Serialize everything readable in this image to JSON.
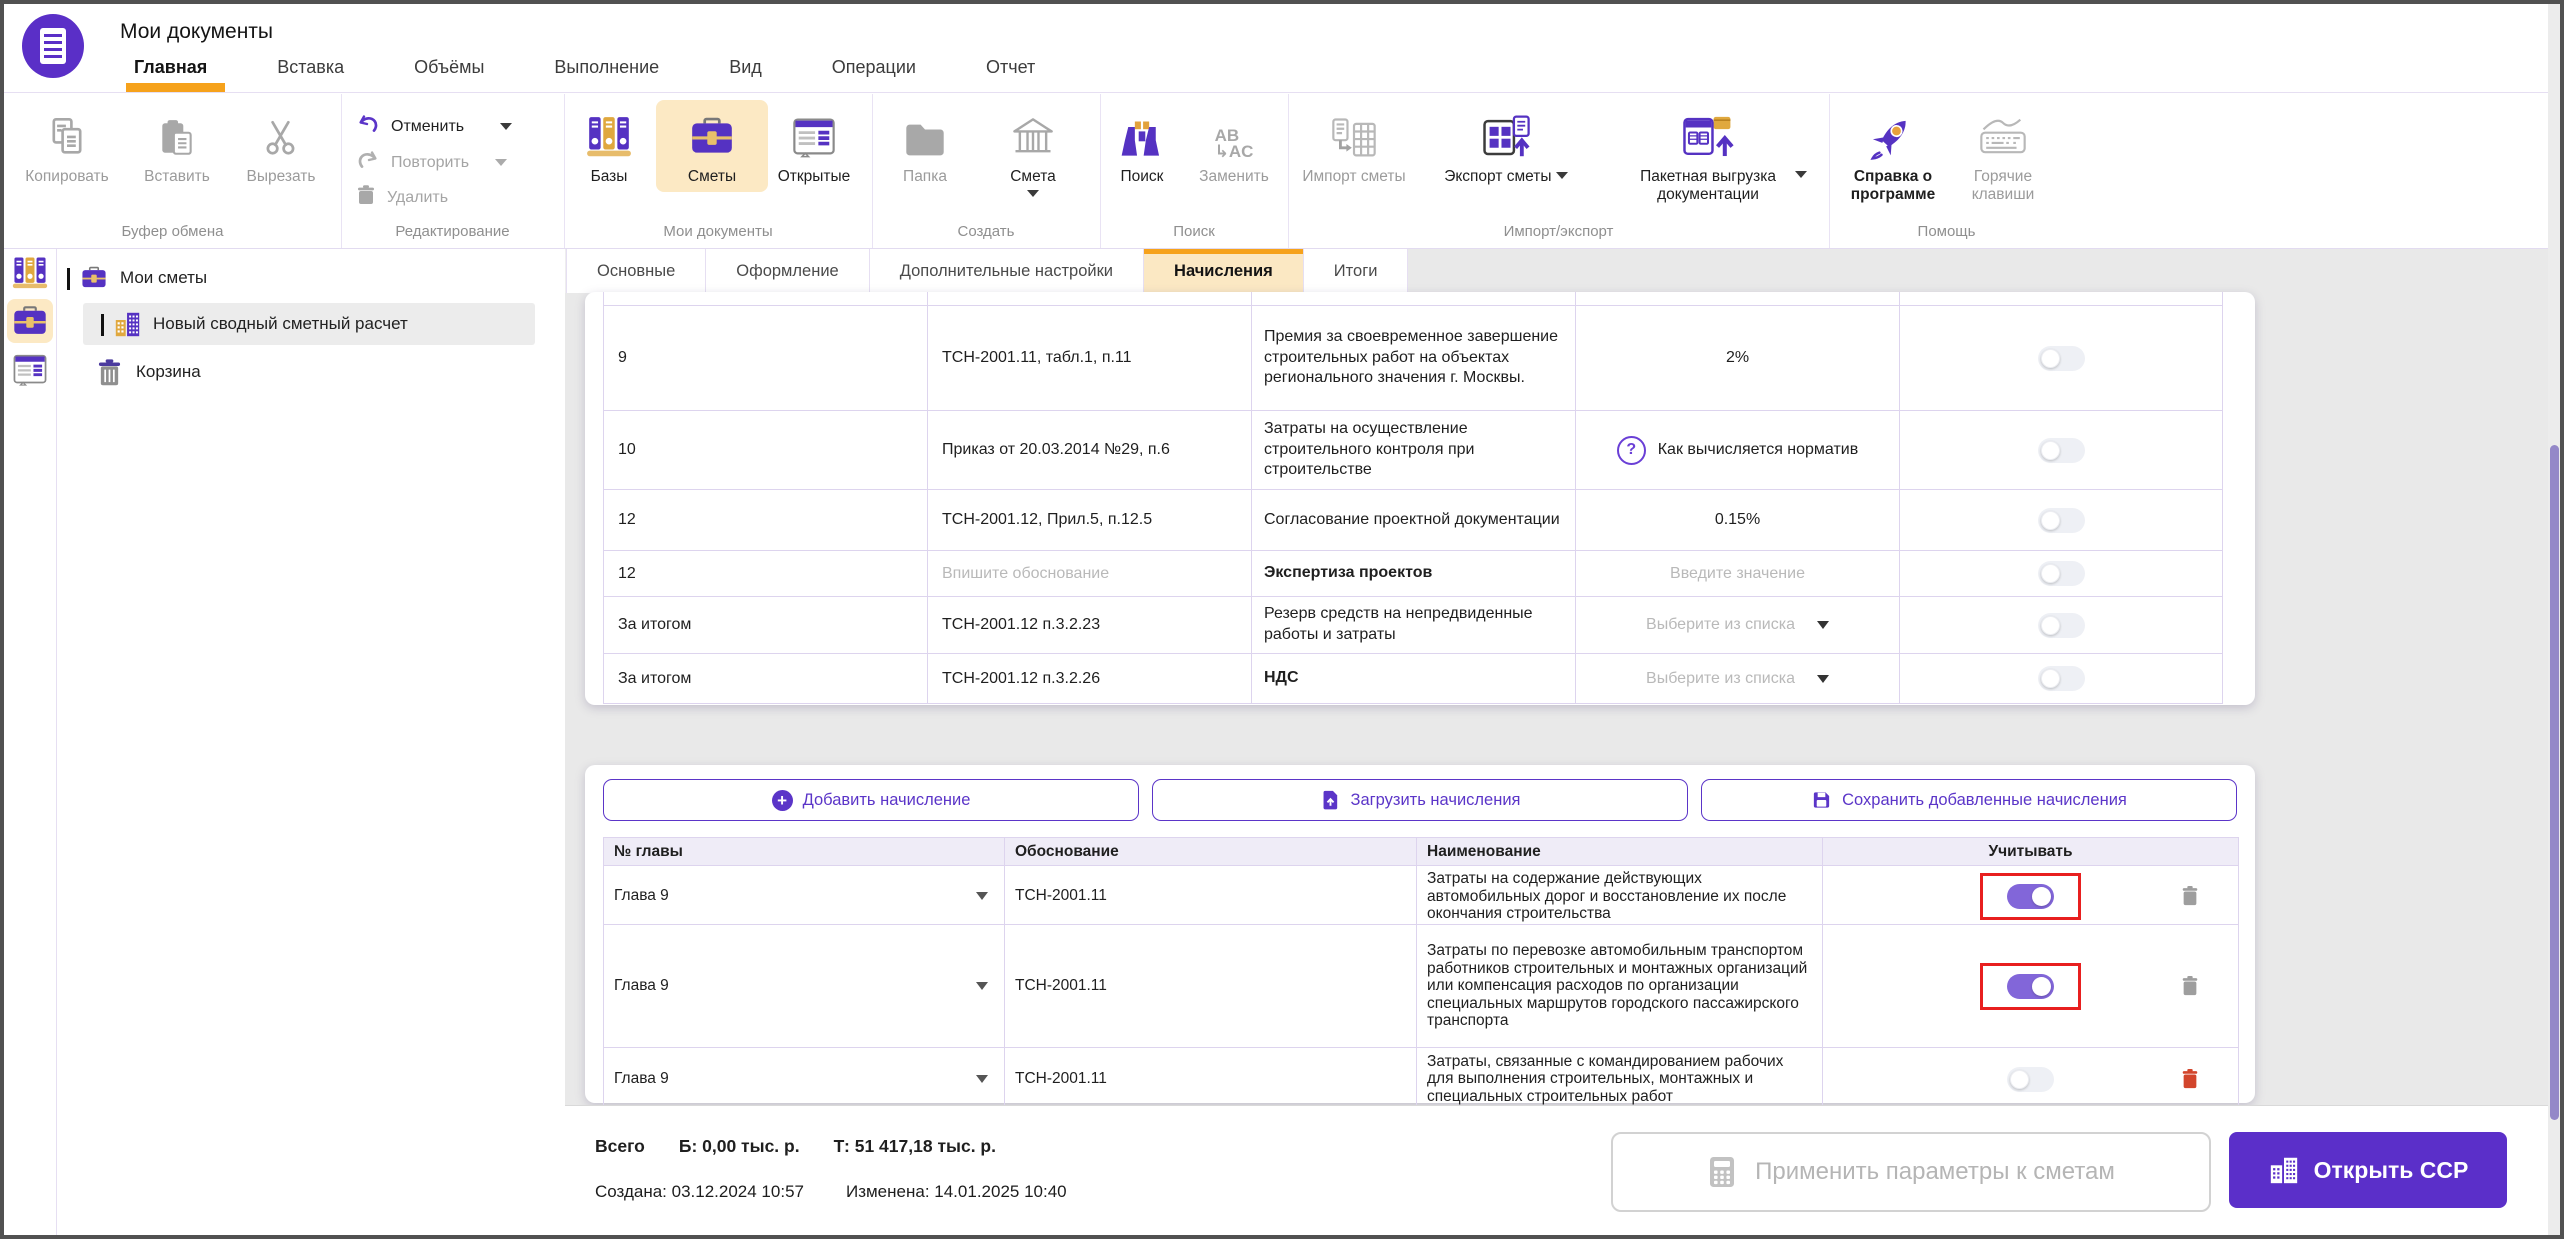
{
  "window": {
    "title": "Мои документы"
  },
  "menu": {
    "tabs": [
      "Главная",
      "Вставка",
      "Объёмы",
      "Выполнение",
      "Вид",
      "Операции",
      "Отчет"
    ],
    "active": "Главная"
  },
  "ribbon": {
    "clipboard": {
      "label": "Буфер обмена",
      "copy": "Копировать",
      "paste": "Вставить",
      "cut": "Вырезать"
    },
    "editing": {
      "label": "Редактирование",
      "undo": "Отменить",
      "redo": "Повторить",
      "delete": "Удалить"
    },
    "mydocs": {
      "label": "Мои документы",
      "bases": "Базы",
      "estimates": "Сметы",
      "opened": "Открытые"
    },
    "create": {
      "label": "Создать",
      "folder": "Папка",
      "estimate": "Смета"
    },
    "search": {
      "label": "Поиск",
      "find": "Поиск",
      "replace_line1": "AB",
      "replace_line2": "↳AC",
      "replace": "Заменить"
    },
    "impexp": {
      "label": "Импорт/экспорт",
      "import": "Импорт сметы",
      "export": "Экспорт сметы",
      "batch": "Пакетная выгрузка документации"
    },
    "help": {
      "label": "Помощь",
      "about": "Справка о программе",
      "hotkeys": "Горячие клавиши"
    }
  },
  "sidebar": {
    "root": "Мои сметы",
    "doc": "Новый сводный сметный расчет",
    "trash": "Корзина"
  },
  "doc_tabs": {
    "tabs": [
      "Основные",
      "Оформление",
      "Дополнительные настройки",
      "Начисления",
      "Итоги"
    ],
    "active": "Начисления"
  },
  "accruals": {
    "rows": [
      {
        "chapter": "9",
        "basis": "ТСН-2001.11, табл.1, п.11",
        "name": "Премия за своевременное завершение строительных работ на объектах регионального значения г. Москвы.",
        "value": "2%",
        "enabled": false
      },
      {
        "chapter": "10",
        "basis": "Приказ от 20.03.2014 №29, п.6",
        "name": "Затраты на осуществление строительного контроля при строительстве",
        "value": "Как вычисляется норматив",
        "enabled": false
      },
      {
        "chapter": "12",
        "basis": "ТСН-2001.12, Прил.5, п.12.5",
        "name": "Согласование проектной документации",
        "value": "0.15%",
        "enabled": false
      },
      {
        "chapter": "12",
        "basis_placeholder": "Впишите обоснование",
        "name": "Экспертиза проектов",
        "value_placeholder": "Введите значение",
        "enabled": false
      },
      {
        "chapter": "За итогом",
        "basis": "ТСН-2001.12 п.3.2.23",
        "name": "Резерв средств на непредвиденные работы и затраты",
        "value_placeholder": "Выберите из списка",
        "enabled": false
      },
      {
        "chapter": "За итогом",
        "basis": "ТСН-2001.12 п.3.2.26",
        "name": "НДС",
        "value_placeholder": "Выберите из списка",
        "enabled": false
      }
    ]
  },
  "custom": {
    "add_button": "Добавить начисление",
    "load_button": "Загрузить начисления",
    "save_button": "Сохранить добавленные начисления",
    "headers": {
      "chapter": "№ главы",
      "basis": "Обоснование",
      "name": "Наименование",
      "consider": "Учитывать"
    },
    "rows": [
      {
        "chapter": "Глава 9",
        "basis": "ТСН-2001.11",
        "name": "Затраты на содержание действующих автомобильных дорог и восстановление их после окончания строительства",
        "enabled": true,
        "highlighted": true
      },
      {
        "chapter": "Глава 9",
        "basis": "ТСН-2001.11",
        "name": "Затраты по перевозке автомобильным транспортом работников строительных и монтажных организаций или компенсация расходов по организации специальных маршрутов городского пассажирского транспорта",
        "enabled": true,
        "highlighted": true
      },
      {
        "chapter": "Глава 9",
        "basis": "ТСН-2001.11",
        "name": "Затраты, связанные с командированием рабочих для выполнения строительных, монтажных и специальных строительных работ",
        "enabled": false,
        "highlighted": false
      }
    ]
  },
  "footer": {
    "total_label": "Всего",
    "total_base": "Б: 0,00 тыс. р.",
    "total_current": "Т: 51 417,18 тыс. р.",
    "created": "Создана: 03.12.2024 10:57",
    "modified": "Изменена: 14.01.2025 10:40",
    "apply_button": "Применить параметры к сметам",
    "open_button": "Открыть ССР"
  },
  "colors": {
    "accent": "#5b2fc9",
    "orange": "#f6a21b",
    "toggle_on": "#8266d9",
    "annotation_red": "#e81f1f",
    "highlight_cream": "#fce9c4"
  }
}
